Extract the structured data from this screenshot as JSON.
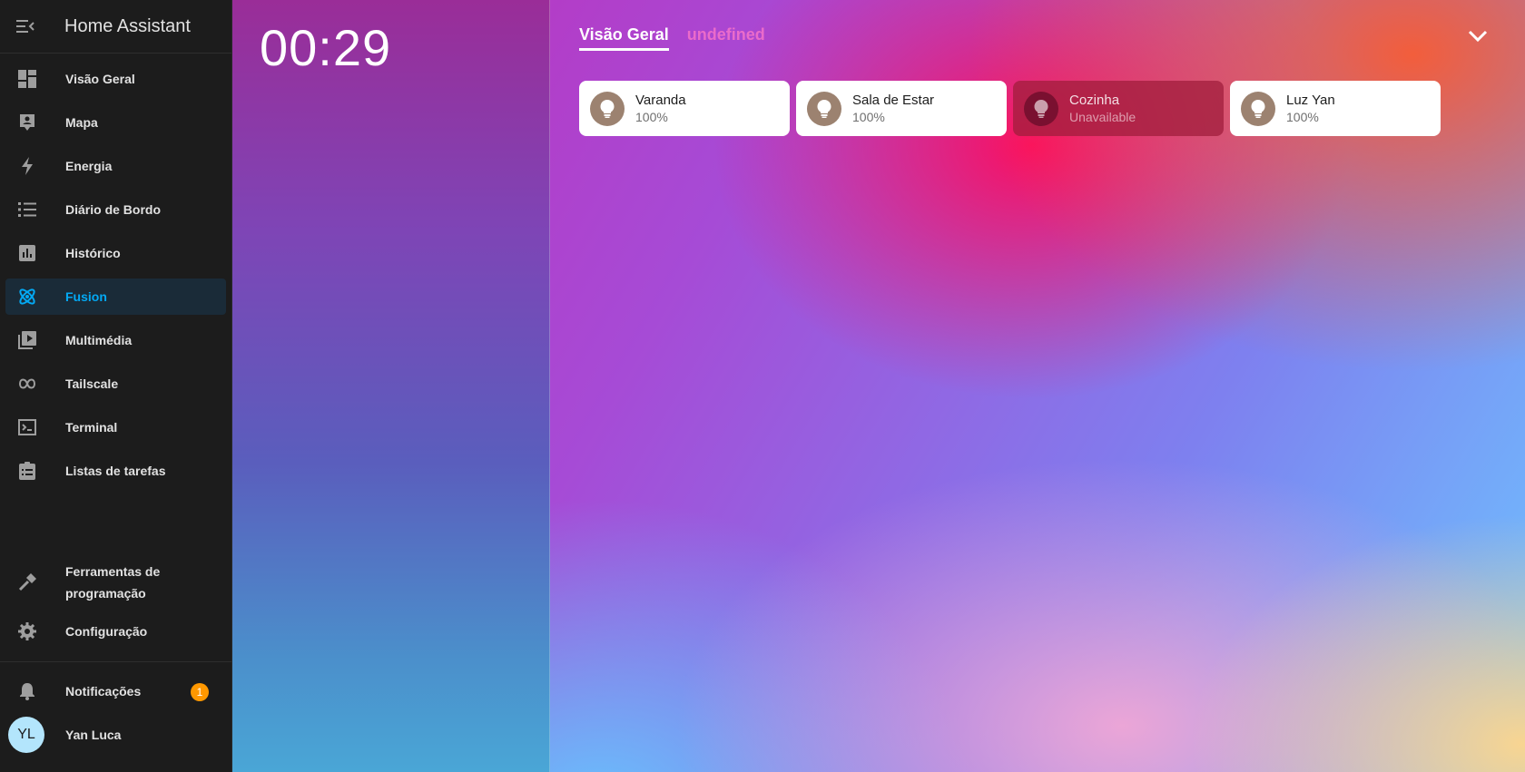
{
  "sidebar": {
    "title": "Home Assistant",
    "items": [
      {
        "label": "Visão Geral",
        "icon": "dashboard-icon"
      },
      {
        "label": "Mapa",
        "icon": "map-icon"
      },
      {
        "label": "Energia",
        "icon": "lightning-icon"
      },
      {
        "label": "Diário de Bordo",
        "icon": "list-icon"
      },
      {
        "label": "Histórico",
        "icon": "chart-box-icon"
      },
      {
        "label": "Fusion",
        "icon": "atom-icon",
        "active": true
      },
      {
        "label": "Multimédia",
        "icon": "play-box-icon"
      },
      {
        "label": "Tailscale",
        "icon": "tailscale-icon"
      },
      {
        "label": "Terminal",
        "icon": "terminal-icon"
      },
      {
        "label": "Listas de tarefas",
        "icon": "clipboard-list-icon"
      }
    ],
    "bottom": {
      "devtools_line1": "Ferramentas de",
      "devtools_line2": "programação",
      "config": "Configuração",
      "notifications": "Notificações",
      "notification_count": "1",
      "user_initials": "YL",
      "user_name": "Yan Luca"
    },
    "accent": "#03a9f4"
  },
  "clock": {
    "time": "00:29"
  },
  "tabs": [
    {
      "label": "Visão Geral",
      "active": true
    },
    {
      "label": "undefined",
      "active": false
    }
  ],
  "cards": [
    {
      "name": "Varanda",
      "state": "100%"
    },
    {
      "name": "Sala de Estar",
      "state": "100%"
    },
    {
      "name": "Cozinha",
      "state": "Unavailable"
    },
    {
      "name": "Luz Yan",
      "state": "100%"
    }
  ]
}
